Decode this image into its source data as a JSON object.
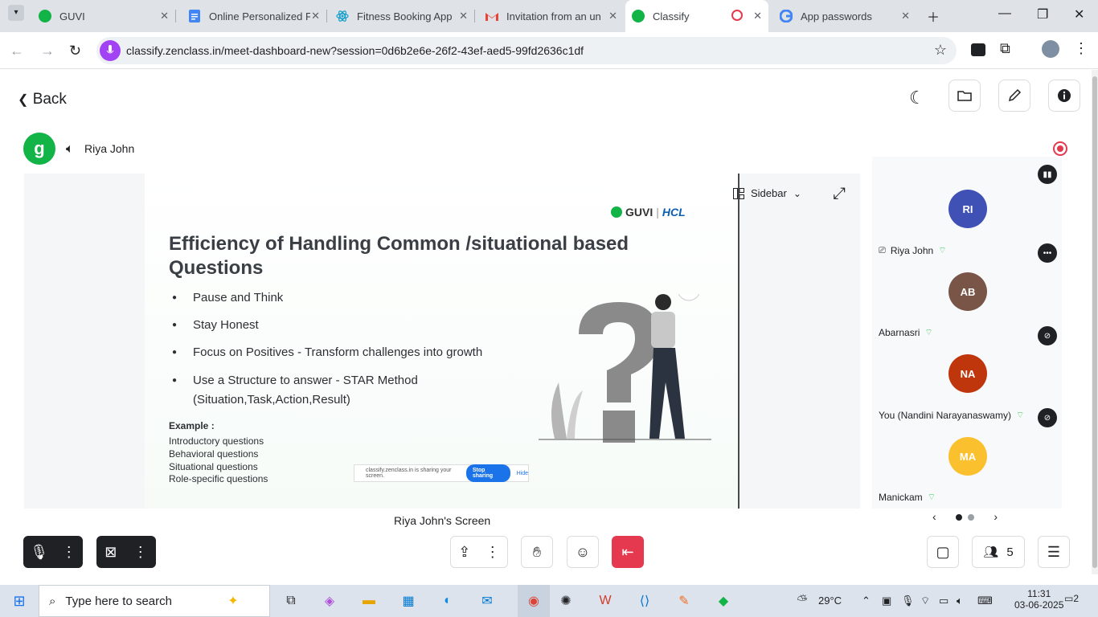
{
  "browser": {
    "tabs": [
      {
        "title": "GUVI",
        "favicon": "guvi-icon"
      },
      {
        "title": "Online Personalized F",
        "favicon": "docs-icon"
      },
      {
        "title": "Fitness Booking App",
        "favicon": "react-icon"
      },
      {
        "title": "Invitation from an un",
        "favicon": "gmail-icon"
      },
      {
        "title": "Classify",
        "favicon": "guvi-icon",
        "active": true
      },
      {
        "title": "App passwords",
        "favicon": "google-icon"
      }
    ],
    "url": "classify.zenclass.in/meet-dashboard-new?session=0d6b2e6e-26f2-43ef-aed5-99fd2636c1df"
  },
  "header": {
    "back_label": "Back"
  },
  "presenter": {
    "name": "Riya John",
    "screen_caption": "Riya John's Screen"
  },
  "stage": {
    "sidebar_label": "Sidebar"
  },
  "slide": {
    "brand": "GUVI",
    "brand_partner": "HCL",
    "title": "Efficiency of Handling Common /situational based Questions",
    "bullets": [
      "Pause and Think",
      "Stay Honest",
      "Focus on Positives - Transform challenges into growth",
      "Use a Structure to answer - STAR Method",
      "(Situation,Task,Action,Result)"
    ],
    "example_heading": "Example :",
    "examples": [
      "Introductory questions",
      "Behavioral  questions",
      "Situational questions",
      "Role-specific questions"
    ],
    "share_notice": "classify.zenclass.in is sharing your screen.",
    "stop_sharing": "Stop sharing",
    "hide": "Hide"
  },
  "participants": [
    {
      "initials": "RI",
      "name": "Riya John",
      "color": "#3f51b5"
    },
    {
      "initials": "AB",
      "name": "Abarnasri",
      "color": "#795548"
    },
    {
      "initials": "NA",
      "name": "You (Nandini Narayanaswamy)",
      "color": "#bf360c"
    },
    {
      "initials": "MA",
      "name": "Manickam",
      "color": "#fbc02d"
    }
  ],
  "controls": {
    "participant_count": "5"
  },
  "taskbar": {
    "search_placeholder": "Type here to search",
    "weather": "29°C",
    "time": "11:31",
    "date": "03-06-2025",
    "notifications": "2"
  },
  "colors": {
    "accent_green": "#12b347",
    "leave_red": "#e53950",
    "wifi_green": "#34c759"
  }
}
